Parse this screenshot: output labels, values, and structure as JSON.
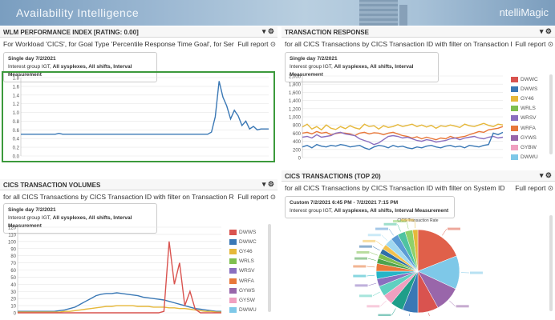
{
  "app": {
    "title": "Availability Intelligence",
    "brand": "ntelliMagic"
  },
  "panels": {
    "wlm": {
      "title": "WLM PERFORMANCE INDEX [RATING: 0.00]",
      "subtitle": "For Workload 'CICS', for Goal Type 'Percentile Response Time Goal', for Servi...",
      "full_report": "Full report",
      "period": "Single day 7/2/2021",
      "filter_prefix": "Interest group IGT,",
      "filter_bold": "All sysplexes, All shifts, Interval Measurement"
    },
    "tresp": {
      "title": "TRANSACTION RESPONSE",
      "subtitle": "for all CICS Transactions by CICS Transaction ID with filter on Transaction Re...",
      "full_report": "Full report",
      "period": "Single day 7/2/2021",
      "filter_prefix": "Interest group IGT,",
      "filter_bold": "All sysplexes, All shifts, Interval Measurement"
    },
    "tvol": {
      "title": "CICS TRANSACTION VOLUMES",
      "subtitle": "for all CICS Transactions by CICS Transaction ID with filter on Transaction Re...",
      "full_report": "Full report",
      "period": "Single day 7/2/2021",
      "filter_prefix": "Interest group IGT,",
      "filter_bold": "All sysplexes, All shifts, Interval Measurement"
    },
    "ttop": {
      "title": "CICS TRANSACTIONS (TOP 20)",
      "subtitle": "for all CICS Transactions by CICS Transaction ID with filter on System ID",
      "full_report": "Full report",
      "period": "Custom 7/2/2021 6:45 PM - 7/2/2021 7:15 PM",
      "filter_prefix": "Interest group IGT,",
      "filter_bold": "All sysplexes, All shifts, Interval Measurement"
    }
  },
  "controls": {
    "collapse": "▾",
    "settings": "⚙",
    "arrow": "⊙"
  },
  "chart_data": [
    {
      "type": "line",
      "ylim": [
        0,
        1.8
      ],
      "yticks": [
        "1.8",
        "1.6",
        "1.4",
        "1.2",
        "1.0",
        "0.8",
        "0.6",
        "0.4",
        "0.2",
        "0.0"
      ],
      "series": [
        {
          "color": "#3a78b5",
          "values": [
            0.5,
            0.5,
            0.5,
            0.5,
            0.5,
            0.5,
            0.5,
            0.5,
            0.5,
            0.5,
            0.52,
            0.5,
            0.5,
            0.5,
            0.5,
            0.5,
            0.5,
            0.5,
            0.5,
            0.5,
            0.5,
            0.5,
            0.5,
            0.5,
            0.5,
            0.5,
            0.5,
            0.5,
            0.5,
            0.5,
            0.5,
            0.5,
            0.5,
            0.5,
            0.5,
            0.5,
            0.5,
            0.5,
            0.5,
            0.5,
            0.5,
            0.5,
            0.5,
            0.5,
            0.5,
            0.5,
            0.5,
            0.5,
            0.5,
            0.5,
            0.55,
            0.9,
            1.72,
            1.35,
            1.15,
            0.85,
            1.05,
            0.92,
            0.7,
            0.8,
            0.62,
            0.68,
            0.6,
            0.62,
            0.62,
            0.62
          ]
        }
      ]
    },
    {
      "type": "line",
      "ylim": [
        0,
        2000
      ],
      "yticks": [
        "2,000",
        "1,800",
        "1,600",
        "1,400",
        "1,200",
        "1,000",
        "800",
        "600",
        "400",
        "200",
        "0"
      ],
      "legend": [
        "DWWC",
        "DWWS",
        "GY46",
        "WRLS",
        "WRSV",
        "WRFA",
        "GYWS",
        "GYBW",
        "DWWU"
      ],
      "colors": [
        "#d9534f",
        "#3a78b5",
        "#e6b83a",
        "#7fbf4f",
        "#8a6fbf",
        "#e8783a",
        "#9966aa",
        "#f0a0c0",
        "#7ec8e8"
      ],
      "series": [
        {
          "name": "GY46",
          "color": "#e6b83a",
          "values": [
            750,
            820,
            700,
            760,
            680,
            800,
            720,
            690,
            760,
            710,
            780,
            730,
            700,
            820,
            760,
            780,
            700,
            780,
            740,
            760,
            810,
            760,
            790,
            820,
            760,
            800,
            750,
            790,
            720,
            780,
            760,
            800,
            770,
            740,
            820,
            780,
            760,
            800,
            840,
            790,
            760,
            820,
            800
          ]
        },
        {
          "name": "WRFA",
          "color": "#e8783a",
          "values": [
            600,
            620,
            580,
            640,
            600,
            620,
            560,
            590,
            610,
            600,
            580,
            540,
            600,
            620,
            580,
            610,
            600,
            560,
            600,
            620,
            580,
            540,
            520,
            480,
            510,
            460,
            500,
            470,
            440,
            480,
            460,
            520,
            480,
            500,
            520,
            560,
            600,
            640,
            620,
            680,
            700,
            720,
            760
          ]
        },
        {
          "name": "WRSV",
          "color": "#8a6fbf",
          "values": [
            500,
            520,
            480,
            560,
            500,
            520,
            540,
            600,
            620,
            580,
            560,
            540,
            460,
            420,
            380,
            320,
            360,
            440,
            520,
            540,
            520,
            480,
            500,
            460,
            420,
            400,
            440,
            420,
            380,
            400,
            420,
            460,
            480,
            440,
            480,
            500,
            520,
            480,
            460,
            500,
            520,
            480,
            500
          ]
        },
        {
          "name": "DWWS",
          "color": "#3a78b5",
          "values": [
            260,
            300,
            240,
            320,
            280,
            260,
            300,
            280,
            320,
            300,
            260,
            280,
            300,
            240,
            200,
            260,
            300,
            280,
            240,
            300,
            260,
            280,
            240,
            220,
            260,
            240,
            280,
            300,
            260,
            240,
            280,
            300,
            260,
            280,
            240,
            300,
            280,
            260,
            300,
            320,
            600,
            560,
            620
          ]
        }
      ]
    },
    {
      "type": "line",
      "ylim": [
        0,
        120
      ],
      "yticks": [
        "120",
        "110",
        "100",
        "90",
        "80",
        "70",
        "60",
        "50",
        "40",
        "30",
        "20",
        "10",
        "0"
      ],
      "legend": [
        "DWWS",
        "DWWC",
        "GY46",
        "WRLS",
        "WRSV",
        "WRFA",
        "GYWS",
        "GYSW",
        "DWWU"
      ],
      "colors": [
        "#d9534f",
        "#3a78b5",
        "#e6b83a",
        "#7fbf4f",
        "#8a6fbf",
        "#e8783a",
        "#9966aa",
        "#f0a0c0",
        "#7ec8e8"
      ],
      "series": [
        {
          "name": "DWWC",
          "color": "#3a78b5",
          "values": [
            2,
            2,
            2,
            2,
            2,
            2,
            2,
            2,
            3,
            4,
            6,
            8,
            12,
            16,
            20,
            24,
            26,
            27,
            27,
            28,
            27,
            26,
            25,
            24,
            22,
            21,
            20,
            19,
            18,
            16,
            14,
            12,
            10,
            8,
            6,
            5,
            4,
            3,
            2,
            2
          ]
        },
        {
          "name": "GY46",
          "color": "#e6b83a",
          "values": [
            1,
            1,
            1,
            1,
            1,
            1,
            1,
            1,
            1,
            2,
            2,
            3,
            4,
            5,
            6,
            7,
            8,
            9,
            9,
            10,
            10,
            10,
            10,
            9,
            9,
            9,
            8,
            8,
            8,
            7,
            7,
            6,
            6,
            5,
            4,
            3,
            2,
            2,
            1,
            1
          ]
        },
        {
          "name": "DWWS",
          "color": "#d9534f",
          "values": [
            0,
            0,
            0,
            0,
            0,
            0,
            0,
            0,
            0,
            0,
            0,
            0,
            0,
            0,
            0,
            0,
            0,
            0,
            0,
            0,
            0,
            0,
            0,
            0,
            0,
            0,
            0,
            0,
            2,
            100,
            40,
            70,
            10,
            30,
            5,
            0,
            0,
            0,
            0,
            0
          ]
        }
      ]
    },
    {
      "type": "pie",
      "title": "CICS Transaction Rate",
      "values": [
        19,
        13,
        10,
        8,
        6,
        5,
        4,
        4,
        3,
        3,
        3,
        2,
        2,
        2,
        2,
        3,
        3,
        3,
        3,
        2
      ],
      "colors": [
        "#e0604a",
        "#7ec8e8",
        "#9966aa",
        "#d9534f",
        "#3a78b5",
        "#1f9e89",
        "#f0a0c0",
        "#5fd0c0",
        "#8a6fbf",
        "#26b5c7",
        "#e8783a",
        "#4da34d",
        "#7fbf4f",
        "#2f6fa8",
        "#f2c14e",
        "#a0d8f0",
        "#5b9bd5",
        "#4fc3a1",
        "#8fd16a",
        "#e6b83a"
      ]
    }
  ]
}
